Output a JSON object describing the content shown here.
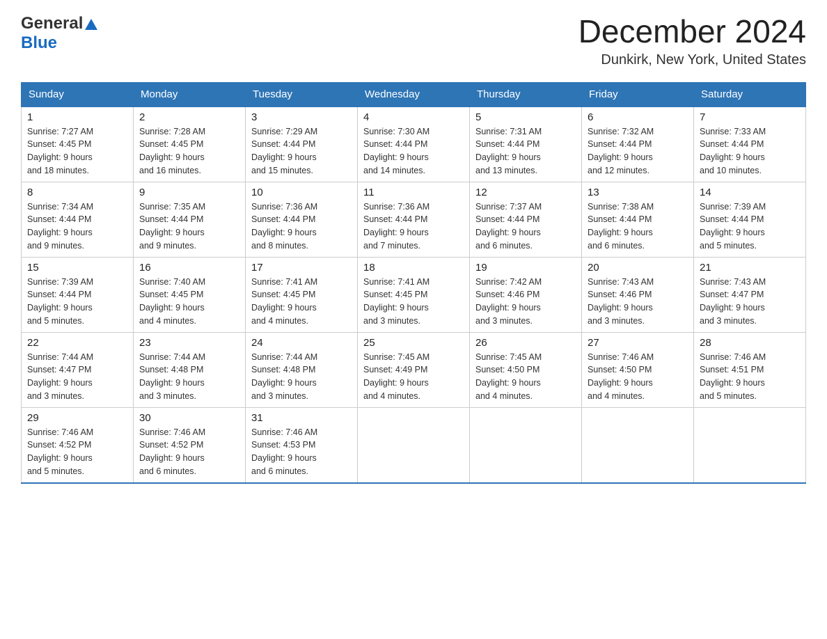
{
  "header": {
    "logo_general": "General",
    "logo_blue": "Blue",
    "main_title": "December 2024",
    "subtitle": "Dunkirk, New York, United States"
  },
  "days_of_week": [
    "Sunday",
    "Monday",
    "Tuesday",
    "Wednesday",
    "Thursday",
    "Friday",
    "Saturday"
  ],
  "weeks": [
    [
      {
        "day": "1",
        "sunrise": "7:27 AM",
        "sunset": "4:45 PM",
        "daylight": "9 hours and 18 minutes."
      },
      {
        "day": "2",
        "sunrise": "7:28 AM",
        "sunset": "4:45 PM",
        "daylight": "9 hours and 16 minutes."
      },
      {
        "day": "3",
        "sunrise": "7:29 AM",
        "sunset": "4:44 PM",
        "daylight": "9 hours and 15 minutes."
      },
      {
        "day": "4",
        "sunrise": "7:30 AM",
        "sunset": "4:44 PM",
        "daylight": "9 hours and 14 minutes."
      },
      {
        "day": "5",
        "sunrise": "7:31 AM",
        "sunset": "4:44 PM",
        "daylight": "9 hours and 13 minutes."
      },
      {
        "day": "6",
        "sunrise": "7:32 AM",
        "sunset": "4:44 PM",
        "daylight": "9 hours and 12 minutes."
      },
      {
        "day": "7",
        "sunrise": "7:33 AM",
        "sunset": "4:44 PM",
        "daylight": "9 hours and 10 minutes."
      }
    ],
    [
      {
        "day": "8",
        "sunrise": "7:34 AM",
        "sunset": "4:44 PM",
        "daylight": "9 hours and 9 minutes."
      },
      {
        "day": "9",
        "sunrise": "7:35 AM",
        "sunset": "4:44 PM",
        "daylight": "9 hours and 9 minutes."
      },
      {
        "day": "10",
        "sunrise": "7:36 AM",
        "sunset": "4:44 PM",
        "daylight": "9 hours and 8 minutes."
      },
      {
        "day": "11",
        "sunrise": "7:36 AM",
        "sunset": "4:44 PM",
        "daylight": "9 hours and 7 minutes."
      },
      {
        "day": "12",
        "sunrise": "7:37 AM",
        "sunset": "4:44 PM",
        "daylight": "9 hours and 6 minutes."
      },
      {
        "day": "13",
        "sunrise": "7:38 AM",
        "sunset": "4:44 PM",
        "daylight": "9 hours and 6 minutes."
      },
      {
        "day": "14",
        "sunrise": "7:39 AM",
        "sunset": "4:44 PM",
        "daylight": "9 hours and 5 minutes."
      }
    ],
    [
      {
        "day": "15",
        "sunrise": "7:39 AM",
        "sunset": "4:44 PM",
        "daylight": "9 hours and 5 minutes."
      },
      {
        "day": "16",
        "sunrise": "7:40 AM",
        "sunset": "4:45 PM",
        "daylight": "9 hours and 4 minutes."
      },
      {
        "day": "17",
        "sunrise": "7:41 AM",
        "sunset": "4:45 PM",
        "daylight": "9 hours and 4 minutes."
      },
      {
        "day": "18",
        "sunrise": "7:41 AM",
        "sunset": "4:45 PM",
        "daylight": "9 hours and 3 minutes."
      },
      {
        "day": "19",
        "sunrise": "7:42 AM",
        "sunset": "4:46 PM",
        "daylight": "9 hours and 3 minutes."
      },
      {
        "day": "20",
        "sunrise": "7:43 AM",
        "sunset": "4:46 PM",
        "daylight": "9 hours and 3 minutes."
      },
      {
        "day": "21",
        "sunrise": "7:43 AM",
        "sunset": "4:47 PM",
        "daylight": "9 hours and 3 minutes."
      }
    ],
    [
      {
        "day": "22",
        "sunrise": "7:44 AM",
        "sunset": "4:47 PM",
        "daylight": "9 hours and 3 minutes."
      },
      {
        "day": "23",
        "sunrise": "7:44 AM",
        "sunset": "4:48 PM",
        "daylight": "9 hours and 3 minutes."
      },
      {
        "day": "24",
        "sunrise": "7:44 AM",
        "sunset": "4:48 PM",
        "daylight": "9 hours and 3 minutes."
      },
      {
        "day": "25",
        "sunrise": "7:45 AM",
        "sunset": "4:49 PM",
        "daylight": "9 hours and 4 minutes."
      },
      {
        "day": "26",
        "sunrise": "7:45 AM",
        "sunset": "4:50 PM",
        "daylight": "9 hours and 4 minutes."
      },
      {
        "day": "27",
        "sunrise": "7:46 AM",
        "sunset": "4:50 PM",
        "daylight": "9 hours and 4 minutes."
      },
      {
        "day": "28",
        "sunrise": "7:46 AM",
        "sunset": "4:51 PM",
        "daylight": "9 hours and 5 minutes."
      }
    ],
    [
      {
        "day": "29",
        "sunrise": "7:46 AM",
        "sunset": "4:52 PM",
        "daylight": "9 hours and 5 minutes."
      },
      {
        "day": "30",
        "sunrise": "7:46 AM",
        "sunset": "4:52 PM",
        "daylight": "9 hours and 6 minutes."
      },
      {
        "day": "31",
        "sunrise": "7:46 AM",
        "sunset": "4:53 PM",
        "daylight": "9 hours and 6 minutes."
      },
      null,
      null,
      null,
      null
    ]
  ],
  "labels": {
    "sunrise": "Sunrise:",
    "sunset": "Sunset:",
    "daylight": "Daylight: 9 hours"
  }
}
